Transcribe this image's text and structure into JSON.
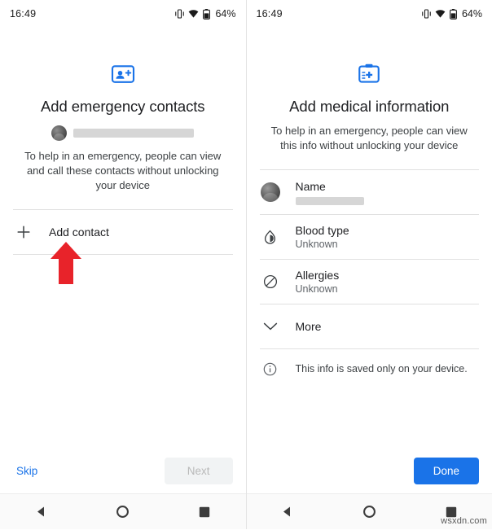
{
  "left": {
    "status": {
      "clock": "16:49",
      "battery": "64%"
    },
    "hero_icon": "emergency-contacts-icon",
    "title": "Add emergency contacts",
    "account_redacted": true,
    "subtitle": "To help in an emergency, people can view and call these contacts without unlocking your device",
    "add_contact_label": "Add contact",
    "buttons": {
      "skip": "Skip",
      "next": "Next"
    }
  },
  "right": {
    "status": {
      "clock": "16:49",
      "battery": "64%"
    },
    "hero_icon": "medical-id-icon",
    "title": "Add medical information",
    "subtitle": "To help in an emergency, people can view this info without unlocking your device",
    "rows": [
      {
        "icon": "avatar-icon",
        "label": "Name",
        "value": "",
        "redacted": true
      },
      {
        "icon": "blood-drop-icon",
        "label": "Blood type",
        "value": "Unknown",
        "redacted": false
      },
      {
        "icon": "allergy-icon",
        "label": "Allergies",
        "value": "Unknown",
        "redacted": false
      },
      {
        "icon": "chevron-down-icon",
        "label": "More",
        "value": "",
        "redacted": false
      }
    ],
    "note": "This info is saved only on your device.",
    "buttons": {
      "done": "Done"
    }
  },
  "watermark": "wsxdn.com",
  "colors": {
    "accent": "#1a73e8",
    "arrow": "#e8232a",
    "text": "#202124",
    "muted": "#5f6368"
  }
}
